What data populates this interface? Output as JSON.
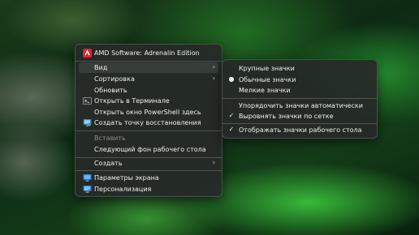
{
  "main_menu": {
    "header": "AMD Software: Adrenalin Edition",
    "items": [
      {
        "label": "Вид"
      },
      {
        "label": "Сортировка"
      },
      {
        "label": "Обновить"
      },
      {
        "label": "Открыть в Терминале"
      },
      {
        "label": "Открыть окно PowerShell здесь"
      },
      {
        "label": "Создать точку восстановления"
      },
      {
        "label": "Вставить"
      },
      {
        "label": "Следующий фон рабочего стола"
      },
      {
        "label": "Создать"
      },
      {
        "label": "Параметры экрана"
      },
      {
        "label": "Персонализация"
      }
    ]
  },
  "view_submenu": {
    "items": [
      {
        "label": "Крупные значки"
      },
      {
        "label": "Обычные значки"
      },
      {
        "label": "Мелкие значки"
      },
      {
        "label": "Упорядочить значки автоматически"
      },
      {
        "label": "Выровнять значки по сетке"
      },
      {
        "label": "Отображать значки рабочего стола"
      }
    ]
  },
  "icons": {
    "amd": "amd-logo-icon",
    "terminal": "terminal-icon",
    "restore": "system-restore-icon",
    "display": "display-settings-icon",
    "personalize": "personalization-icon",
    "submenu_arrow": "chevron-right-icon",
    "radio": "radio-dot-icon",
    "check": "checkmark-icon"
  },
  "colors": {
    "amd_red": "#d8262e",
    "menu_bg": "#262a28"
  }
}
